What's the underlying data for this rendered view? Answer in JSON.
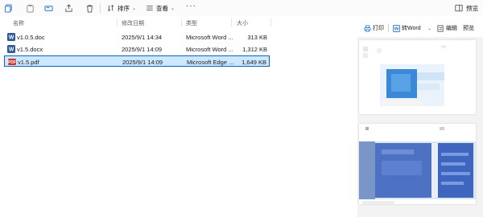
{
  "toolbar": {
    "icons": [
      "copy-icon",
      "paste-icon",
      "rename-icon",
      "share-icon",
      "delete-icon"
    ],
    "sort_label": "排序",
    "view_label": "查看",
    "more_label": "···",
    "preview_label": "预览"
  },
  "columns": {
    "name": "名称",
    "modified": "修改日期",
    "type": "类型",
    "size": "大小"
  },
  "files": [
    {
      "name": "v1.0.5.doc",
      "modified": "2025/9/1 14:34",
      "type": "Microsoft Word ...",
      "size": "313 KB",
      "icon": "word-icon",
      "selected": false
    },
    {
      "name": "v1.5.docx",
      "modified": "2025/9/1 14:09",
      "type": "Microsoft Word ...",
      "size": "1,312 KB",
      "icon": "word-icon",
      "selected": false
    },
    {
      "name": "v1.5.pdf",
      "modified": "2025/9/1 14:09",
      "type": "Microsoft Edge ...",
      "size": "1,649 KB",
      "icon": "pdf-icon",
      "selected": true
    }
  ],
  "preview_toolbar": {
    "print_label": "打印",
    "to_word_label": "转Word",
    "edit_label": "编辑",
    "preview_label": "预览"
  },
  "colors": {
    "selection_bg": "#cce8ff",
    "selection_border": "#0a62c4",
    "word_blue": "#2b579a",
    "pdf_red": "#d0312d"
  }
}
